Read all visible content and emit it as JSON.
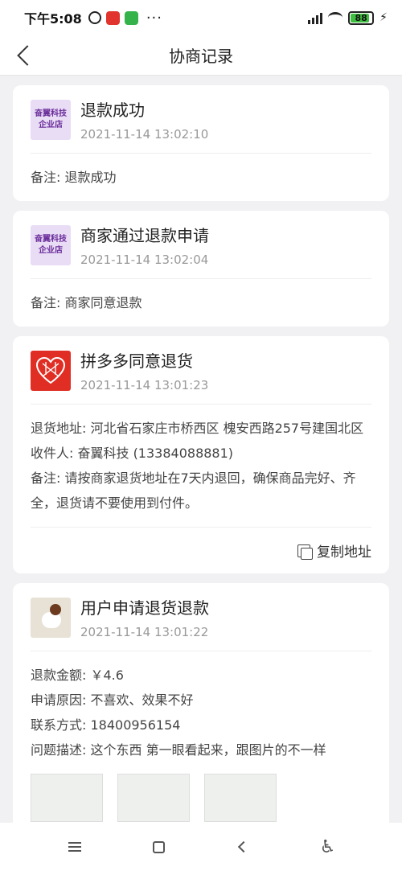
{
  "status_bar": {
    "time": "下午5:08",
    "battery": "88",
    "battery_level": 0.88
  },
  "header": {
    "title": "协商记录"
  },
  "records": [
    {
      "avatar_type": "shop",
      "avatar_text_line1": "奋翼科技",
      "avatar_text_line2": "企业店",
      "title": "退款成功",
      "time": "2021-11-14 13:02:10",
      "lines": [
        "备注: 退款成功"
      ]
    },
    {
      "avatar_type": "shop",
      "avatar_text_line1": "奋翼科技",
      "avatar_text_line2": "企业店",
      "title": "商家通过退款申请",
      "time": "2021-11-14 13:02:04",
      "lines": [
        "备注: 商家同意退款"
      ]
    },
    {
      "avatar_type": "platform",
      "title": "拼多多同意退货",
      "time": "2021-11-14 13:01:23",
      "lines": [
        "退货地址: 河北省石家庄市桥西区 槐安西路257号建国北区",
        "收件人: 奋翼科技 (13384088881)",
        "备注: 请按商家退货地址在7天内退回，确保商品完好、齐全，退货请不要使用到付件。"
      ],
      "action_label": "复制地址"
    },
    {
      "avatar_type": "user",
      "title": "用户申请退货退款",
      "time": "2021-11-14 13:01:22",
      "lines": [
        "退款金额: ￥4.6",
        "申请原因: 不喜欢、效果不好",
        "联系方式: 18400956154",
        "问题描述: 这个东西 第一眼看起来，跟图片的不一样"
      ]
    }
  ],
  "colors": {
    "page_bg": "#f1f1f3",
    "platform_red": "#e02e24",
    "shop_avatar_bg": "#e9dcf5",
    "shop_avatar_text": "#6a2d9a"
  },
  "icons": {
    "back": "chevron-left-icon",
    "copy": "copy-icon",
    "nav": [
      "menu-icon",
      "home-icon",
      "back-icon",
      "accessibility-icon"
    ]
  }
}
